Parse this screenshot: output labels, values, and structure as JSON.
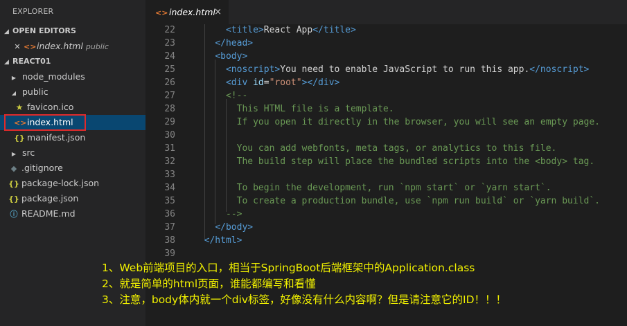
{
  "explorer": {
    "title": "EXPLORER",
    "open_editors": {
      "label": "OPEN EDITORS",
      "items": [
        {
          "name": "index.html",
          "folder": "public"
        }
      ]
    },
    "project": {
      "label": "REACT01",
      "items": [
        {
          "name": "node_modules",
          "kind": "folder"
        },
        {
          "name": "public",
          "kind": "folder-open"
        },
        {
          "name": "favicon.ico",
          "kind": "star"
        },
        {
          "name": "index.html",
          "kind": "html"
        },
        {
          "name": "manifest.json",
          "kind": "json"
        },
        {
          "name": "src",
          "kind": "folder"
        },
        {
          "name": ".gitignore",
          "kind": "git"
        },
        {
          "name": "package-lock.json",
          "kind": "json"
        },
        {
          "name": "package.json",
          "kind": "json"
        },
        {
          "name": "README.md",
          "kind": "info"
        }
      ]
    }
  },
  "tab": {
    "name": "index.html",
    "close": "×"
  },
  "editor": {
    "lines": [
      {
        "n": "22",
        "parts": [
          [
            "",
            "      "
          ],
          [
            "tag",
            "<title>"
          ],
          [
            "",
            "React App"
          ],
          [
            "tag",
            "</title>"
          ]
        ]
      },
      {
        "n": "23",
        "parts": [
          [
            "",
            "    "
          ],
          [
            "tag",
            "</head>"
          ]
        ]
      },
      {
        "n": "24",
        "parts": [
          [
            "",
            "    "
          ],
          [
            "tag",
            "<body>"
          ]
        ]
      },
      {
        "n": "25",
        "parts": [
          [
            "",
            "      "
          ],
          [
            "tag",
            "<noscript>"
          ],
          [
            "",
            "You need to enable JavaScript to run this app."
          ],
          [
            "tag",
            "</noscript>"
          ]
        ]
      },
      {
        "n": "26",
        "parts": [
          [
            "",
            "      "
          ],
          [
            "tag",
            "<div "
          ],
          [
            "attr",
            "id"
          ],
          [
            "",
            "="
          ],
          [
            "str",
            "\"root\""
          ],
          [
            "tag",
            "></div>"
          ]
        ]
      },
      {
        "n": "27",
        "parts": [
          [
            "",
            "      "
          ],
          [
            "cmt",
            "<!--"
          ]
        ]
      },
      {
        "n": "28",
        "parts": [
          [
            "cmt",
            "        This HTML file is a template."
          ]
        ]
      },
      {
        "n": "29",
        "parts": [
          [
            "cmt",
            "        If you open it directly in the browser, you will see an empty page."
          ]
        ]
      },
      {
        "n": "30",
        "parts": []
      },
      {
        "n": "31",
        "parts": [
          [
            "cmt",
            "        You can add webfonts, meta tags, or analytics to this file."
          ]
        ]
      },
      {
        "n": "32",
        "parts": [
          [
            "cmt",
            "        The build step will place the bundled scripts into the <body> tag."
          ]
        ]
      },
      {
        "n": "33",
        "parts": []
      },
      {
        "n": "34",
        "parts": [
          [
            "cmt",
            "        To begin the development, run `npm start` or `yarn start`."
          ]
        ]
      },
      {
        "n": "35",
        "parts": [
          [
            "cmt",
            "        To create a production bundle, use `npm run build` or `yarn build`."
          ]
        ]
      },
      {
        "n": "36",
        "parts": [
          [
            "cmt",
            "      -->"
          ]
        ]
      },
      {
        "n": "37",
        "parts": [
          [
            "",
            "    "
          ],
          [
            "tag",
            "</body>"
          ]
        ]
      },
      {
        "n": "38",
        "parts": [
          [
            "",
            "  "
          ],
          [
            "tag",
            "</html>"
          ]
        ]
      },
      {
        "n": "39",
        "parts": []
      }
    ]
  },
  "notes": [
    "1、Web前端项目的入口，相当于SpringBoot后端框架中的Application.class",
    "2、就是简单的html页面，谁能都编写和看懂",
    "3、注意，body体内就一个div标签，好像没有什么内容啊？但是请注意它的ID！！！"
  ],
  "colors": {
    "highlight_box": "#e02a2a",
    "note_text": "#f0f000",
    "selection": "#094771"
  }
}
